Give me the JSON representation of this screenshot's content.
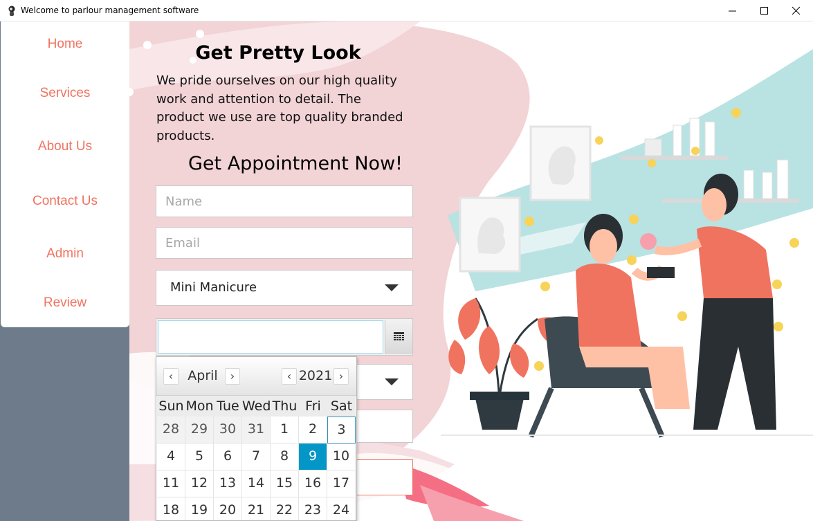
{
  "window": {
    "title": "Welcome to parlour management software"
  },
  "nav": {
    "items": [
      {
        "label": "Home"
      },
      {
        "label": "Services"
      },
      {
        "label": "About Us"
      },
      {
        "label": "Contact Us"
      },
      {
        "label": "Admin"
      },
      {
        "label": "Review"
      }
    ]
  },
  "hero": {
    "title": "Get Pretty Look",
    "description": "We pride ourselves on our high quality work and attention to detail. The product we use are top quality branded products.",
    "appointment_heading": "Get Appointment Now!"
  },
  "form": {
    "name_placeholder": "Name",
    "email_placeholder": "Email",
    "service_value": "Mini Manicure",
    "date_value": ""
  },
  "calendar": {
    "month": "April",
    "year": "2021",
    "weekdays": [
      "Sun",
      "Mon",
      "Tue",
      "Wed",
      "Thu",
      "Fri",
      "Sat"
    ],
    "weeks": [
      [
        "28",
        "29",
        "30",
        "31",
        "1",
        "2",
        "3"
      ],
      [
        "4",
        "5",
        "6",
        "7",
        "8",
        "9",
        "10"
      ],
      [
        "11",
        "12",
        "13",
        "14",
        "15",
        "16",
        "17"
      ],
      [
        "18",
        "19",
        "20",
        "21",
        "22",
        "23",
        "24"
      ]
    ],
    "prev_month_days": [
      "28",
      "29",
      "30",
      "31"
    ],
    "today": "3",
    "selected": "9"
  },
  "colors": {
    "accent": "#f07360",
    "sidebar_bg": "#6e7b8b",
    "selected_day": "#0396c6",
    "pink_bg": "#f2d3d6",
    "teal_stroke": "#b9e2e3"
  }
}
